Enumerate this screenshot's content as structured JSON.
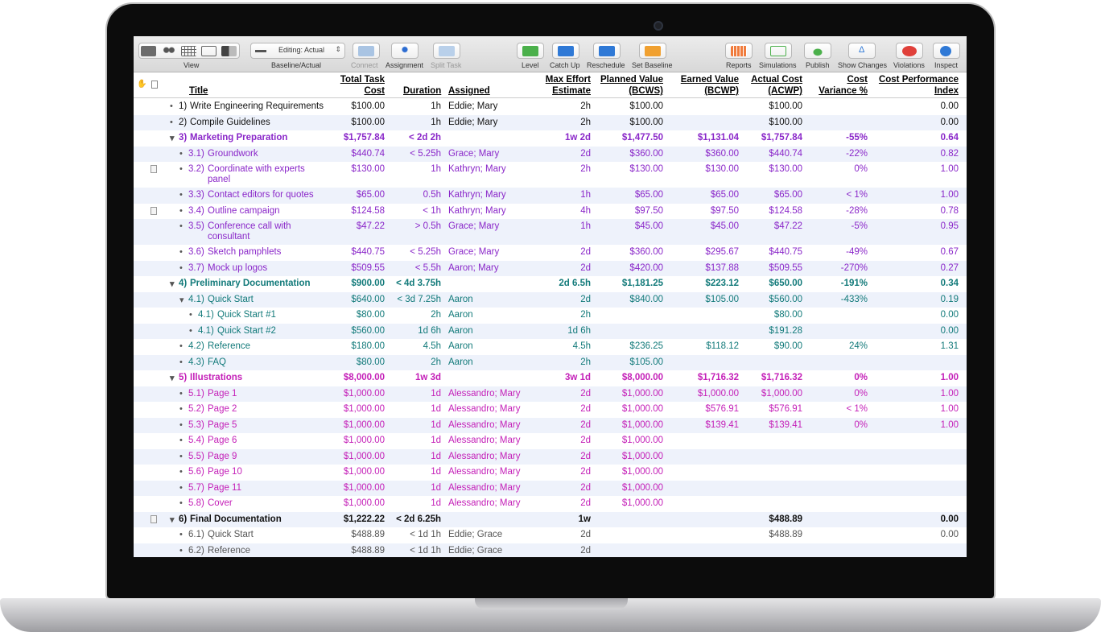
{
  "toolbar": {
    "view": "View",
    "mode": "Editing: Actual",
    "baseline": "Baseline/Actual",
    "connect": "Connect",
    "assignment": "Assignment",
    "split": "Split Task",
    "level": "Level",
    "catchup": "Catch Up",
    "reschedule": "Reschedule",
    "setbaseline": "Set Baseline",
    "reports": "Reports",
    "simulations": "Simulations",
    "publish": "Publish",
    "showchanges": "Show Changes",
    "violations": "Violations",
    "inspect": "Inspect"
  },
  "columns": {
    "title": "Title",
    "cost1": "Total Task",
    "cost2": "Cost",
    "duration": "Duration",
    "assigned": "Assigned",
    "max1": "Max Effort",
    "max2": "Estimate",
    "pv1": "Planned Value",
    "pv2": "(BCWS)",
    "ev1": "Earned Value",
    "ev2": "(BCWP)",
    "ac1": "Actual Cost",
    "ac2": "(ACWP)",
    "cv1": "Cost",
    "cv2": "Variance %",
    "cpi1": "Cost Performance",
    "cpi2": "Index"
  },
  "rows": [
    {
      "num": "1)",
      "title": "Write Engineering Requirements",
      "cost": "$100.00",
      "dur": "1h",
      "asg": "Eddie; Mary",
      "max": "2h",
      "pv": "$100.00",
      "ev": "",
      "ac": "$100.00",
      "cv": "",
      "cpi": "0.00",
      "style": "black",
      "lvl": 0,
      "bold": false,
      "tri": false
    },
    {
      "num": "2)",
      "title": "Compile Guidelines",
      "cost": "$100.00",
      "dur": "1h",
      "asg": "Eddie; Mary",
      "max": "2h",
      "pv": "$100.00",
      "ev": "",
      "ac": "$100.00",
      "cv": "",
      "cpi": "0.00",
      "style": "black",
      "lvl": 0,
      "bold": false,
      "tri": false
    },
    {
      "num": "3)",
      "title": "Marketing Preparation",
      "cost": "$1,757.84",
      "dur": "< 2d 2h",
      "asg": "",
      "max": "1w 2d",
      "pv": "$1,477.50",
      "ev": "$1,131.04",
      "ac": "$1,757.84",
      "cv": "-55%",
      "cpi": "0.64",
      "style": "purple",
      "lvl": 0,
      "bold": true,
      "tri": true
    },
    {
      "num": "3.1)",
      "title": "Groundwork",
      "cost": "$440.74",
      "dur": "< 5.25h",
      "asg": "Grace; Mary",
      "max": "2d",
      "pv": "$360.00",
      "ev": "$360.00",
      "ac": "$440.74",
      "cv": "-22%",
      "cpi": "0.82",
      "style": "purple",
      "lvl": 1,
      "bold": false,
      "tri": false
    },
    {
      "num": "3.2)",
      "title": "Coordinate with experts",
      "title2": "panel",
      "cost": "$130.00",
      "dur": "1h",
      "asg": "Kathryn; Mary",
      "max": "2h",
      "pv": "$130.00",
      "ev": "$130.00",
      "ac": "$130.00",
      "cv": "0%",
      "cpi": "1.00",
      "style": "purple",
      "lvl": 1,
      "bold": false,
      "tri": false,
      "note": true
    },
    {
      "num": "3.3)",
      "title": "Contact editors for quotes",
      "cost": "$65.00",
      "dur": "0.5h",
      "asg": "Kathryn; Mary",
      "max": "1h",
      "pv": "$65.00",
      "ev": "$65.00",
      "ac": "$65.00",
      "cv": "< 1%",
      "cpi": "1.00",
      "style": "purple",
      "lvl": 1,
      "bold": false,
      "tri": false
    },
    {
      "num": "3.4)",
      "title": "Outline campaign",
      "cost": "$124.58",
      "dur": "< 1h",
      "asg": "Kathryn; Mary",
      "max": "4h",
      "pv": "$97.50",
      "ev": "$97.50",
      "ac": "$124.58",
      "cv": "-28%",
      "cpi": "0.78",
      "style": "purple",
      "lvl": 1,
      "bold": false,
      "tri": false,
      "note": true
    },
    {
      "num": "3.5)",
      "title": "Conference call with",
      "title2": "consultant",
      "cost": "$47.22",
      "dur": "> 0.5h",
      "asg": "Grace; Mary",
      "max": "1h",
      "pv": "$45.00",
      "ev": "$45.00",
      "ac": "$47.22",
      "cv": "-5%",
      "cpi": "0.95",
      "style": "purple",
      "lvl": 1,
      "bold": false,
      "tri": false
    },
    {
      "num": "3.6)",
      "title": "Sketch pamphlets",
      "cost": "$440.75",
      "dur": "< 5.25h",
      "asg": "Grace; Mary",
      "max": "2d",
      "pv": "$360.00",
      "ev": "$295.67",
      "ac": "$440.75",
      "cv": "-49%",
      "cpi": "0.67",
      "style": "purple",
      "lvl": 1,
      "bold": false,
      "tri": false
    },
    {
      "num": "3.7)",
      "title": "Mock up logos",
      "cost": "$509.55",
      "dur": "< 5.5h",
      "asg": "Aaron; Mary",
      "max": "2d",
      "pv": "$420.00",
      "ev": "$137.88",
      "ac": "$509.55",
      "cv": "-270%",
      "cpi": "0.27",
      "style": "purple",
      "lvl": 1,
      "bold": false,
      "tri": false
    },
    {
      "num": "4)",
      "title": "Preliminary Documentation",
      "cost": "$900.00",
      "dur": "< 4d 3.75h",
      "asg": "",
      "max": "2d 6.5h",
      "pv": "$1,181.25",
      "ev": "$223.12",
      "ac": "$650.00",
      "cv": "-191%",
      "cpi": "0.34",
      "style": "teal",
      "lvl": 0,
      "bold": true,
      "tri": true
    },
    {
      "num": "4.1)",
      "title": "Quick Start",
      "cost": "$640.00",
      "dur": "< 3d 7.25h",
      "asg": "Aaron",
      "max": "2d",
      "pv": "$840.00",
      "ev": "$105.00",
      "ac": "$560.00",
      "cv": "-433%",
      "cpi": "0.19",
      "style": "teal",
      "lvl": 1,
      "bold": false,
      "tri": true
    },
    {
      "num": "4.1)",
      "title": "Quick Start #1",
      "cost": "$80.00",
      "dur": "2h",
      "asg": "Aaron",
      "max": "2h",
      "pv": "",
      "ev": "",
      "ac": "$80.00",
      "cv": "",
      "cpi": "0.00",
      "style": "teal",
      "lvl": 2,
      "bold": false,
      "tri": false
    },
    {
      "num": "4.1)",
      "title": "Quick Start #2",
      "cost": "$560.00",
      "dur": "1d 6h",
      "asg": "Aaron",
      "max": "1d 6h",
      "pv": "",
      "ev": "",
      "ac": "$191.28",
      "cv": "",
      "cpi": "0.00",
      "style": "teal",
      "lvl": 2,
      "bold": false,
      "tri": false
    },
    {
      "num": "4.2)",
      "title": "Reference",
      "cost": "$180.00",
      "dur": "4.5h",
      "asg": "Aaron",
      "max": "4.5h",
      "pv": "$236.25",
      "ev": "$118.12",
      "ac": "$90.00",
      "cv": "24%",
      "cpi": "1.31",
      "style": "teal",
      "lvl": 1,
      "bold": false,
      "tri": false
    },
    {
      "num": "4.3)",
      "title": "FAQ",
      "cost": "$80.00",
      "dur": "2h",
      "asg": "Aaron",
      "max": "2h",
      "pv": "$105.00",
      "ev": "",
      "ac": "",
      "cv": "",
      "cpi": "",
      "style": "teal",
      "lvl": 1,
      "bold": false,
      "tri": false
    },
    {
      "num": "5)",
      "title": "Illustrations",
      "cost": "$8,000.00",
      "dur": "1w 3d",
      "asg": "",
      "max": "3w 1d",
      "pv": "$8,000.00",
      "ev": "$1,716.32",
      "ac": "$1,716.32",
      "cv": "0%",
      "cpi": "1.00",
      "style": "magenta",
      "lvl": 0,
      "bold": true,
      "tri": true
    },
    {
      "num": "5.1)",
      "title": "Page 1",
      "cost": "$1,000.00",
      "dur": "1d",
      "asg": "Alessandro; Mary",
      "max": "2d",
      "pv": "$1,000.00",
      "ev": "$1,000.00",
      "ac": "$1,000.00",
      "cv": "0%",
      "cpi": "1.00",
      "style": "magenta",
      "lvl": 1,
      "bold": false,
      "tri": false
    },
    {
      "num": "5.2)",
      "title": "Page 2",
      "cost": "$1,000.00",
      "dur": "1d",
      "asg": "Alessandro; Mary",
      "max": "2d",
      "pv": "$1,000.00",
      "ev": "$576.91",
      "ac": "$576.91",
      "cv": "< 1%",
      "cpi": "1.00",
      "style": "magenta",
      "lvl": 1,
      "bold": false,
      "tri": false
    },
    {
      "num": "5.3)",
      "title": "Page 5",
      "cost": "$1,000.00",
      "dur": "1d",
      "asg": "Alessandro; Mary",
      "max": "2d",
      "pv": "$1,000.00",
      "ev": "$139.41",
      "ac": "$139.41",
      "cv": "0%",
      "cpi": "1.00",
      "style": "magenta",
      "lvl": 1,
      "bold": false,
      "tri": false
    },
    {
      "num": "5.4)",
      "title": "Page 6",
      "cost": "$1,000.00",
      "dur": "1d",
      "asg": "Alessandro; Mary",
      "max": "2d",
      "pv": "$1,000.00",
      "ev": "",
      "ac": "",
      "cv": "",
      "cpi": "",
      "style": "magenta",
      "lvl": 1,
      "bold": false,
      "tri": false
    },
    {
      "num": "5.5)",
      "title": "Page 9",
      "cost": "$1,000.00",
      "dur": "1d",
      "asg": "Alessandro; Mary",
      "max": "2d",
      "pv": "$1,000.00",
      "ev": "",
      "ac": "",
      "cv": "",
      "cpi": "",
      "style": "magenta",
      "lvl": 1,
      "bold": false,
      "tri": false
    },
    {
      "num": "5.6)",
      "title": "Page 10",
      "cost": "$1,000.00",
      "dur": "1d",
      "asg": "Alessandro; Mary",
      "max": "2d",
      "pv": "$1,000.00",
      "ev": "",
      "ac": "",
      "cv": "",
      "cpi": "",
      "style": "magenta",
      "lvl": 1,
      "bold": false,
      "tri": false
    },
    {
      "num": "5.7)",
      "title": "Page 11",
      "cost": "$1,000.00",
      "dur": "1d",
      "asg": "Alessandro; Mary",
      "max": "2d",
      "pv": "$1,000.00",
      "ev": "",
      "ac": "",
      "cv": "",
      "cpi": "",
      "style": "magenta",
      "lvl": 1,
      "bold": false,
      "tri": false
    },
    {
      "num": "5.8)",
      "title": "Cover",
      "cost": "$1,000.00",
      "dur": "1d",
      "asg": "Alessandro; Mary",
      "max": "2d",
      "pv": "$1,000.00",
      "ev": "",
      "ac": "",
      "cv": "",
      "cpi": "",
      "style": "magenta",
      "lvl": 1,
      "bold": false,
      "tri": false
    },
    {
      "num": "6)",
      "title": "Final Documentation",
      "cost": "$1,222.22",
      "dur": "< 2d 6.25h",
      "asg": "",
      "max": "1w",
      "pv": "",
      "ev": "",
      "ac": "$488.89",
      "cv": "",
      "cpi": "0.00",
      "style": "black",
      "lvl": 0,
      "bold": true,
      "tri": true,
      "note": true
    },
    {
      "num": "6.1)",
      "title": "Quick Start",
      "cost": "$488.89",
      "dur": "< 1d 1h",
      "asg": "Eddie; Grace",
      "max": "2d",
      "pv": "",
      "ev": "",
      "ac": "$488.89",
      "cv": "",
      "cpi": "0.00",
      "style": "gray",
      "lvl": 1,
      "bold": false,
      "tri": false
    },
    {
      "num": "6.2)",
      "title": "Reference",
      "cost": "$488.89",
      "dur": "< 1d 1h",
      "asg": "Eddie; Grace",
      "max": "2d",
      "pv": "",
      "ev": "",
      "ac": "",
      "cv": "",
      "cpi": "",
      "style": "gray",
      "lvl": 1,
      "bold": false,
      "tri": false
    }
  ]
}
